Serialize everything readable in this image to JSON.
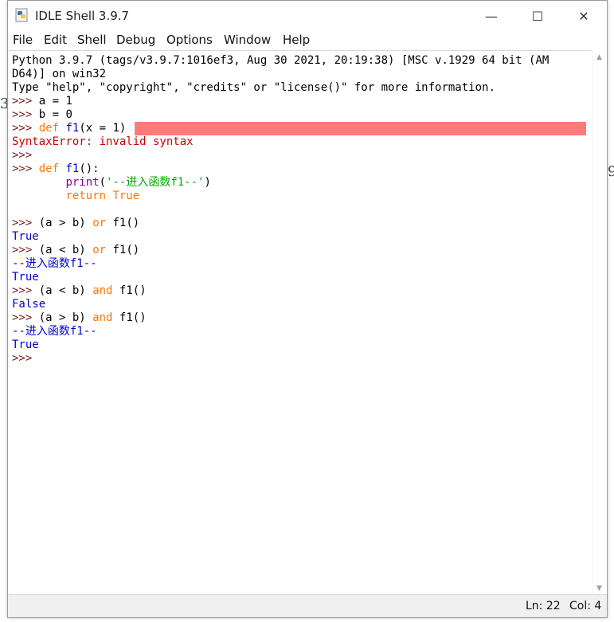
{
  "window": {
    "title": "IDLE Shell 3.9.7"
  },
  "controls": {
    "minimize": "—",
    "maximize": "☐",
    "close": "✕"
  },
  "menu": [
    "File",
    "Edit",
    "Shell",
    "Debug",
    "Options",
    "Window",
    "Help"
  ],
  "shell": {
    "banner1": "Python 3.9.7 (tags/v3.9.7:1016ef3, Aug 30 2021, 20:19:38) [MSC v.1929 64 bit (AM",
    "banner2": "D64)] on win32",
    "banner3": "Type \"help\", \"copyright\", \"credits\" or \"license()\" for more information.",
    "prompt": ">>>",
    "l_a": "a = 1",
    "l_b": "b = 0",
    "def": "def",
    "f1": "f1",
    "bad_args": "(x = 1)",
    "error": "SyntaxError: invalid syntax",
    "def_tail": "():",
    "print": "print",
    "print_paren_open": "(",
    "print_str": "'--进入函数f1--'",
    "print_paren_close": ")",
    "return": "return",
    "true_kw": "True",
    "expr_gt": "(a > b)",
    "expr_lt": "(a < b)",
    "or": "or",
    "and": "and",
    "call": "f1()",
    "out_true": "True",
    "out_false": "False",
    "out_enter": "--进入函数f1--"
  },
  "status": {
    "ln": "Ln: 22",
    "col": "Col: 4"
  },
  "colors": {
    "keyword": "#ff7700",
    "output": "#0000cc",
    "error": "#cc0000",
    "string": "#00aa00",
    "builtin": "#900090",
    "error_highlight": "#ff7b7b"
  }
}
